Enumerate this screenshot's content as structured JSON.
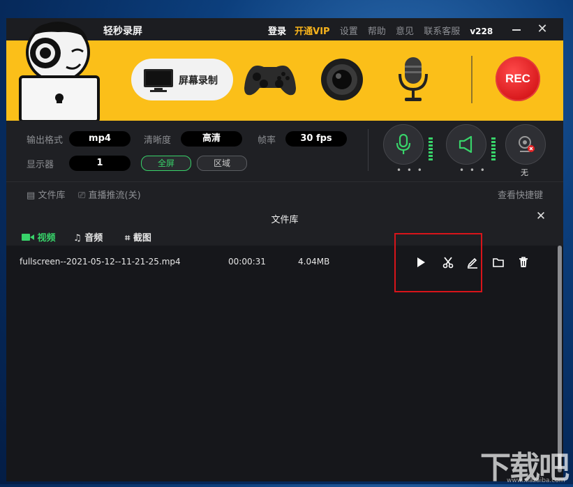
{
  "app": {
    "title": "轻秒录屏",
    "nav": {
      "login": "登录",
      "vip": "开通VIP",
      "settings": "设置",
      "help": "帮助",
      "feedback": "意见",
      "service": "联系客服",
      "version": "v228"
    }
  },
  "toolbar": {
    "screen_record": "屏幕录制",
    "rec": "REC"
  },
  "settings": {
    "format_label": "输出格式",
    "format_value": "mp4",
    "quality_label": "清晰度",
    "quality_value": "高清",
    "fps_label": "帧率",
    "fps_value": "30 fps",
    "display_label": "显示器",
    "display_value": "1",
    "fullscreen": "全屏",
    "region": "区域",
    "webcam_none": "无",
    "dots": "• • •"
  },
  "subbar": {
    "library": "文件库",
    "live": "直播推流(关)",
    "shortcuts": "查看快捷键"
  },
  "library": {
    "title": "文件库",
    "tabs": {
      "video": "视频",
      "audio": "音频",
      "screenshot": "截图"
    },
    "files": [
      {
        "name": "fullscreen--2021-05-12--11-21-25.mp4",
        "duration": "00:00:31",
        "size": "4.04MB"
      }
    ]
  },
  "watermark": {
    "logo": "下载吧",
    "url": "www.xiazaiba.com"
  },
  "colors": {
    "accent_yellow": "#fbbf19",
    "green": "#38d36a",
    "rec_red": "#e32123",
    "highlight": "#d8141a"
  }
}
